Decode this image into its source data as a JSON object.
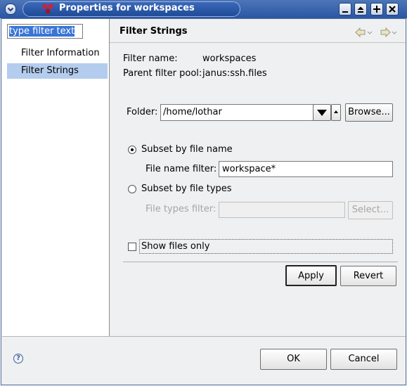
{
  "window": {
    "title": "Properties for workspaces"
  },
  "sidebar": {
    "filter_placeholder": "type filter text",
    "items": [
      {
        "label": "Filter Information",
        "selected": false
      },
      {
        "label": "Filter Strings",
        "selected": true
      }
    ]
  },
  "page": {
    "title": "Filter Strings",
    "filter_name_label": "Filter name:",
    "filter_name_value": "workspaces",
    "parent_pool_label": "Parent filter pool:",
    "parent_pool_value": "janus:ssh.files",
    "folder_label": "Folder:",
    "folder_value": "/home/lothar",
    "browse_label": "Browse...",
    "subset_name_label": "Subset by file name",
    "file_name_filter_label": "File name filter:",
    "file_name_filter_value": "workspace*",
    "subset_types_label": "Subset by file types",
    "file_types_filter_label": "File types filter:",
    "file_types_filter_value": "",
    "select_label": "Select...",
    "show_files_only_label": "Show files only",
    "apply_label": "Apply",
    "revert_label": "Revert"
  },
  "footer": {
    "ok_label": "OK",
    "cancel_label": "Cancel"
  },
  "state": {
    "subset_mode": "file name",
    "show_files_only": false
  },
  "icons": [
    "window-menu-icon",
    "app-icon",
    "minimize-icon",
    "maximize-icon",
    "close-icon",
    "back-arrow-icon",
    "forward-arrow-icon",
    "dropdown-arrow-icon",
    "help-icon"
  ],
  "colors": {
    "titlebar": "#2a55a3",
    "selection": "#b4cdee"
  }
}
